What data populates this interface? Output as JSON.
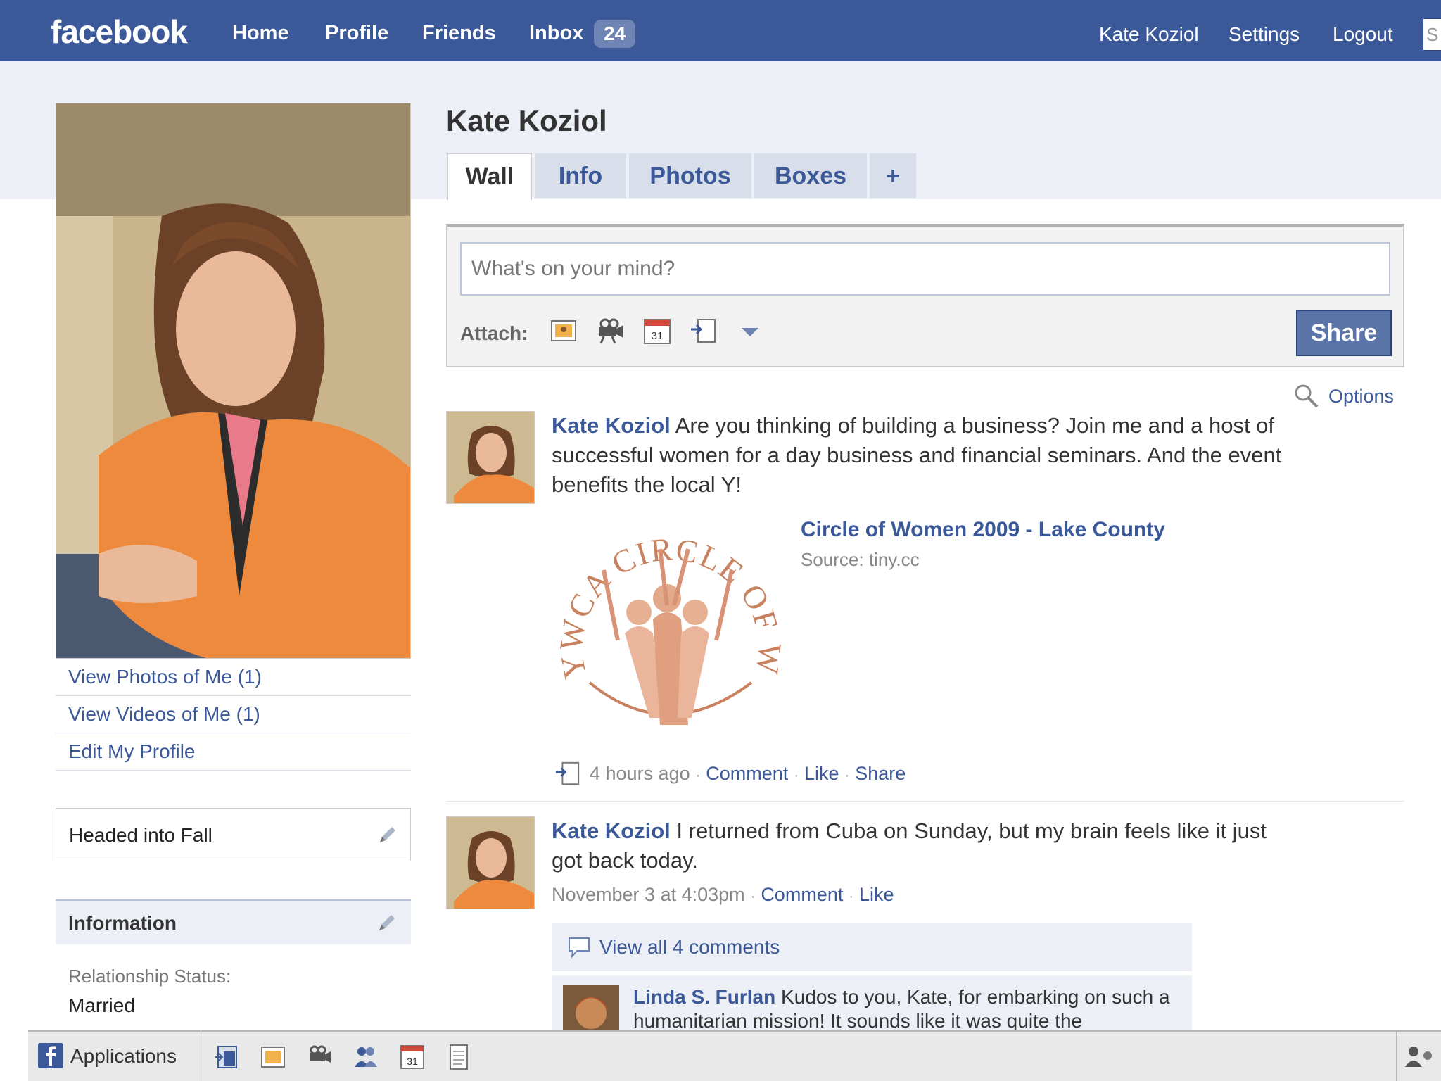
{
  "topbar": {
    "logo": "facebook",
    "nav": [
      "Home",
      "Profile",
      "Friends",
      "Inbox"
    ],
    "inbox_count": "24",
    "user_name": "Kate Koziol",
    "settings": "Settings",
    "logout": "Logout",
    "search_partial": "S"
  },
  "profile": {
    "name": "Kate Koziol",
    "tabs": [
      "Wall",
      "Info",
      "Photos",
      "Boxes",
      "+"
    ],
    "photo_links": [
      "View Photos of Me (1)",
      "View Videos of Me (1)",
      "Edit My Profile"
    ],
    "status": "Headed into Fall",
    "information_title": "Information",
    "relationship_label": "Relationship Status:",
    "relationship_value": "Married"
  },
  "publisher": {
    "placeholder": "What's on your mind?",
    "attach_label": "Attach:",
    "share_label": "Share"
  },
  "options_label": "Options",
  "posts": [
    {
      "author": "Kate Koziol",
      "text": "Are you thinking of building a business? Join me and a host of successful women for a day business and financial seminars. And the event benefits the local Y!",
      "link_title": "Circle of Women 2009 - Lake County",
      "link_source": "Source: tiny.cc",
      "logo_text": "YWCA CIRCLE OF WOMEN",
      "time": "4 hours ago",
      "actions": [
        "Comment",
        "Like",
        "Share"
      ]
    },
    {
      "author": "Kate Koziol",
      "text": "I returned from Cuba on Sunday, but my brain feels like it just got back today.",
      "time": "November 3 at 4:03pm",
      "actions": [
        "Comment",
        "Like"
      ],
      "view_comments": "View all 4 comments",
      "comment": {
        "author": "Linda S. Furlan",
        "text": "Kudos to you, Kate, for embarking on such a humanitarian mission! It sounds like it was quite the experience!"
      }
    }
  ],
  "bottombar": {
    "applications": "Applications"
  },
  "colors": {
    "brand": "#3b5998",
    "band": "#eceff5",
    "link": "#3b5998"
  }
}
